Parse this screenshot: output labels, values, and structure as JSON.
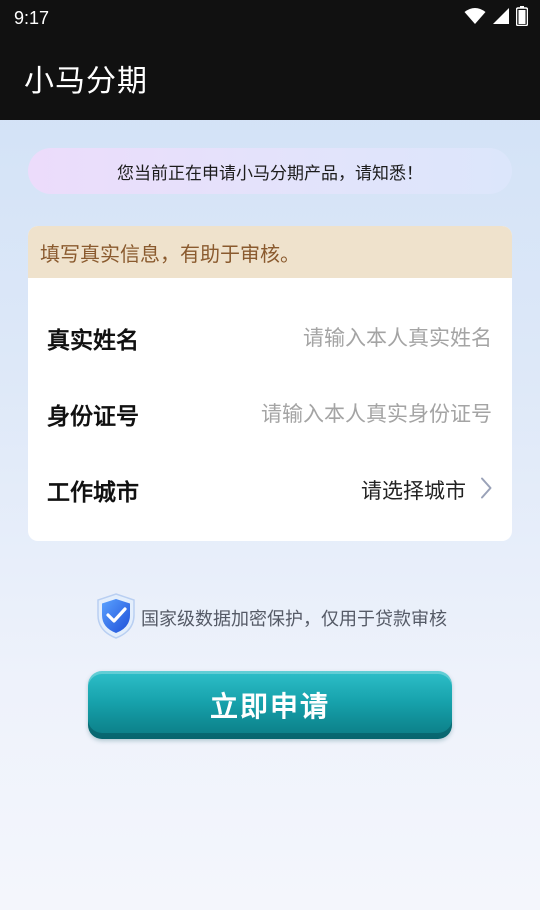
{
  "status_bar": {
    "time": "9:17",
    "icons": [
      "wifi-icon",
      "cellular-signal-icon",
      "battery-icon"
    ]
  },
  "app_bar": {
    "title": "小马分期"
  },
  "notice": {
    "text": "您当前正在申请小马分期产品，请知悉！"
  },
  "form": {
    "hint": "填写真实信息，有助于审核。",
    "fields": [
      {
        "label": "真实姓名",
        "placeholder": "请输入本人真实姓名",
        "value": ""
      },
      {
        "label": "身份证号",
        "placeholder": "请输入本人真实身份证号",
        "value": ""
      },
      {
        "label": "工作城市",
        "value": "请选择城市"
      }
    ]
  },
  "security": {
    "text": "国家级数据加密保护，仅用于贷款审核",
    "icon": "shield-check-icon"
  },
  "apply_button": {
    "label": "立即申请"
  },
  "colors": {
    "top_bar": "#111111",
    "hint_bg": "#efe2cc",
    "hint_text": "#8a5a2e",
    "button": "#17a2ac"
  }
}
